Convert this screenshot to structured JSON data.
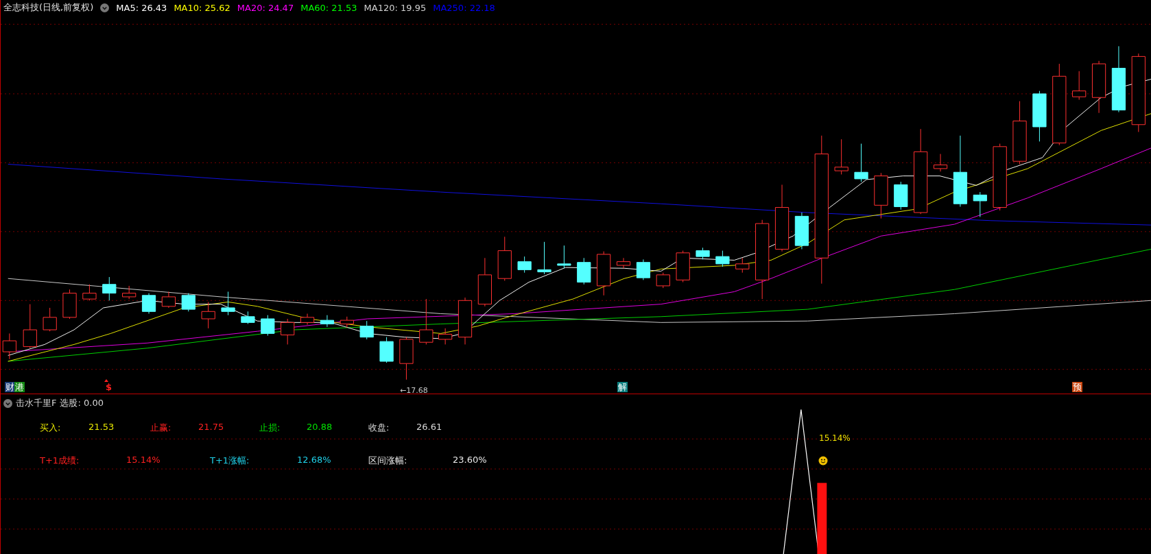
{
  "header": {
    "title": "全志科技(日线,前复权)",
    "indicators": [
      {
        "label": "MA5: 26.43",
        "color": "#ffffff"
      },
      {
        "label": "MA10: 25.62",
        "color": "#ffff00"
      },
      {
        "label": "MA20: 24.47",
        "color": "#ff00ff"
      },
      {
        "label": "MA60: 21.53",
        "color": "#00ff00"
      },
      {
        "label": "MA120: 19.95",
        "color": "#d0d0d0"
      },
      {
        "label": "MA250: 22.18",
        "color": "#0000ff"
      }
    ]
  },
  "chart": {
    "low_label": "←17.68",
    "markers": [
      {
        "kind": "tag",
        "text": "财",
        "color": "#1c3f7a"
      },
      {
        "kind": "tag",
        "text": "港",
        "color": "#138a13"
      },
      {
        "kind": "signal",
        "text": "$",
        "color": "#ff2020"
      },
      {
        "kind": "tag",
        "text": "解",
        "color": "#0b7f7f"
      },
      {
        "kind": "tag",
        "text": "预",
        "color": "#c8430c"
      }
    ]
  },
  "indicator_panel": {
    "title": "击水千里F",
    "reading": "选股: 0.00",
    "peak_label": "15.14%",
    "rows": [
      {
        "items": [
          {
            "label": "买入:",
            "value": "21.53",
            "color": "#e6e600"
          },
          {
            "label": "止赢:",
            "value": "21.75",
            "color": "#ff2020"
          },
          {
            "label": "止损:",
            "value": "20.88",
            "color": "#00e000"
          },
          {
            "label": "收盘:",
            "value": "26.61",
            "color": "#d8d8d8"
          }
        ]
      },
      {
        "items": [
          {
            "label": "T+1成绩:",
            "value": "15.14%",
            "color": "#ff2020"
          },
          {
            "label": "T+1涨幅:",
            "value": "12.68%",
            "color": "#20d0e8"
          },
          {
            "label": "区间涨幅:",
            "value": "23.60%",
            "color": "#e8e8e8"
          }
        ]
      }
    ]
  }
}
